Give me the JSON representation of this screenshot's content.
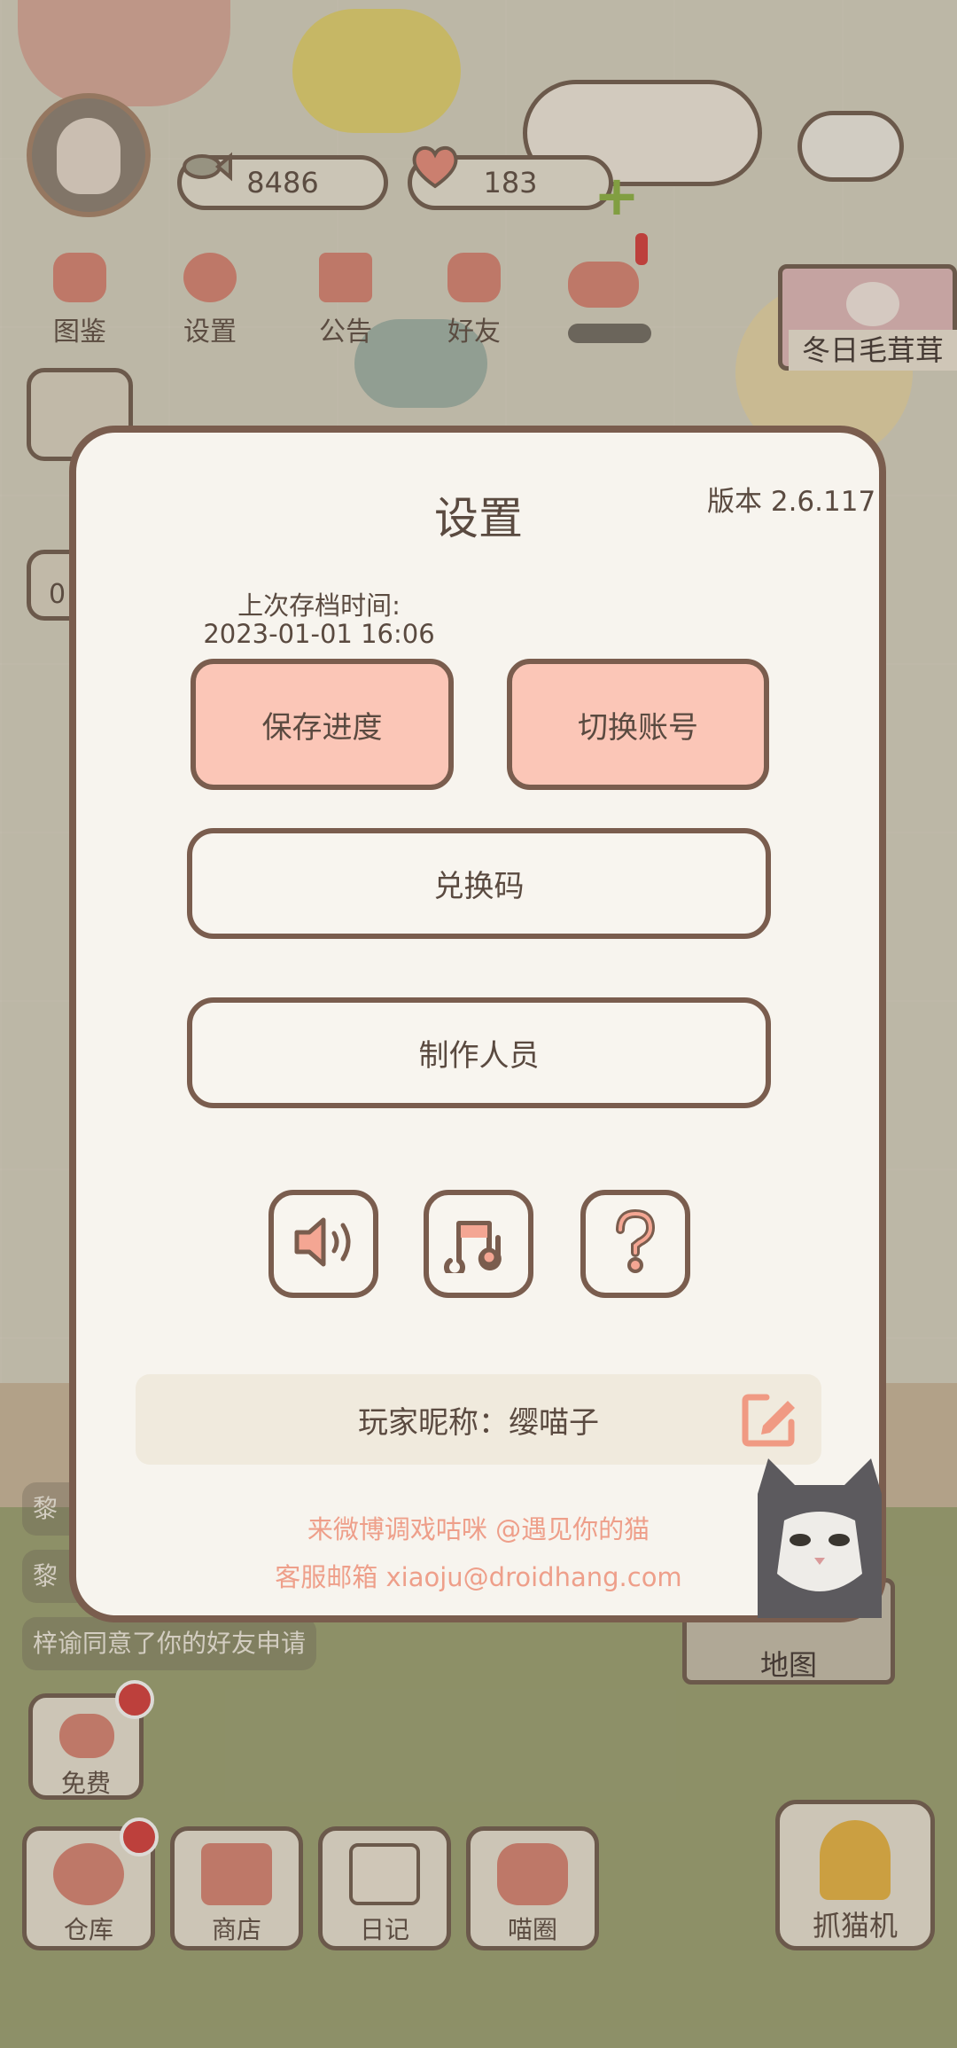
{
  "hud": {
    "coins": "8486",
    "hearts": "183"
  },
  "top_nav": [
    {
      "label": "图鉴"
    },
    {
      "label": "设置"
    },
    {
      "label": "公告"
    },
    {
      "label": "好友"
    }
  ],
  "event_banner": {
    "label": "冬日毛茸茸"
  },
  "dialog": {
    "title": "设置",
    "version": "版本 2.6.117",
    "save_time_label": "上次存档时间:",
    "save_time": "2023-01-01 16:06",
    "save_button": "保存进度",
    "switch_account_button": "切换账号",
    "redeem_button": "兑换码",
    "credits_button": "制作人员",
    "icons": [
      "sound-icon",
      "music-icon",
      "help-icon"
    ],
    "nickname_text": "玩家昵称：缨喵子",
    "footer_weibo": "来微博调戏咕咪 @遇见你的猫",
    "footer_email": "客服邮箱 xiaoju@droidhang.com"
  },
  "notifications": [
    {
      "text": "黎"
    },
    {
      "text": "黎"
    },
    {
      "text": "梓谕同意了你的好友申请"
    }
  ],
  "side_counter": "0",
  "map_button": "地图",
  "free_button": "免费",
  "bottom_nav": [
    {
      "label": "仓库"
    },
    {
      "label": "商店"
    },
    {
      "label": "日记"
    },
    {
      "label": "喵圈"
    }
  ],
  "claw_button": "抓猫机",
  "colors": {
    "accent_pink": "#fbc6b7",
    "border_brown": "#7a5d4e",
    "footer_text": "#ee9f8a",
    "dialog_bg": "#f7f4ee"
  }
}
